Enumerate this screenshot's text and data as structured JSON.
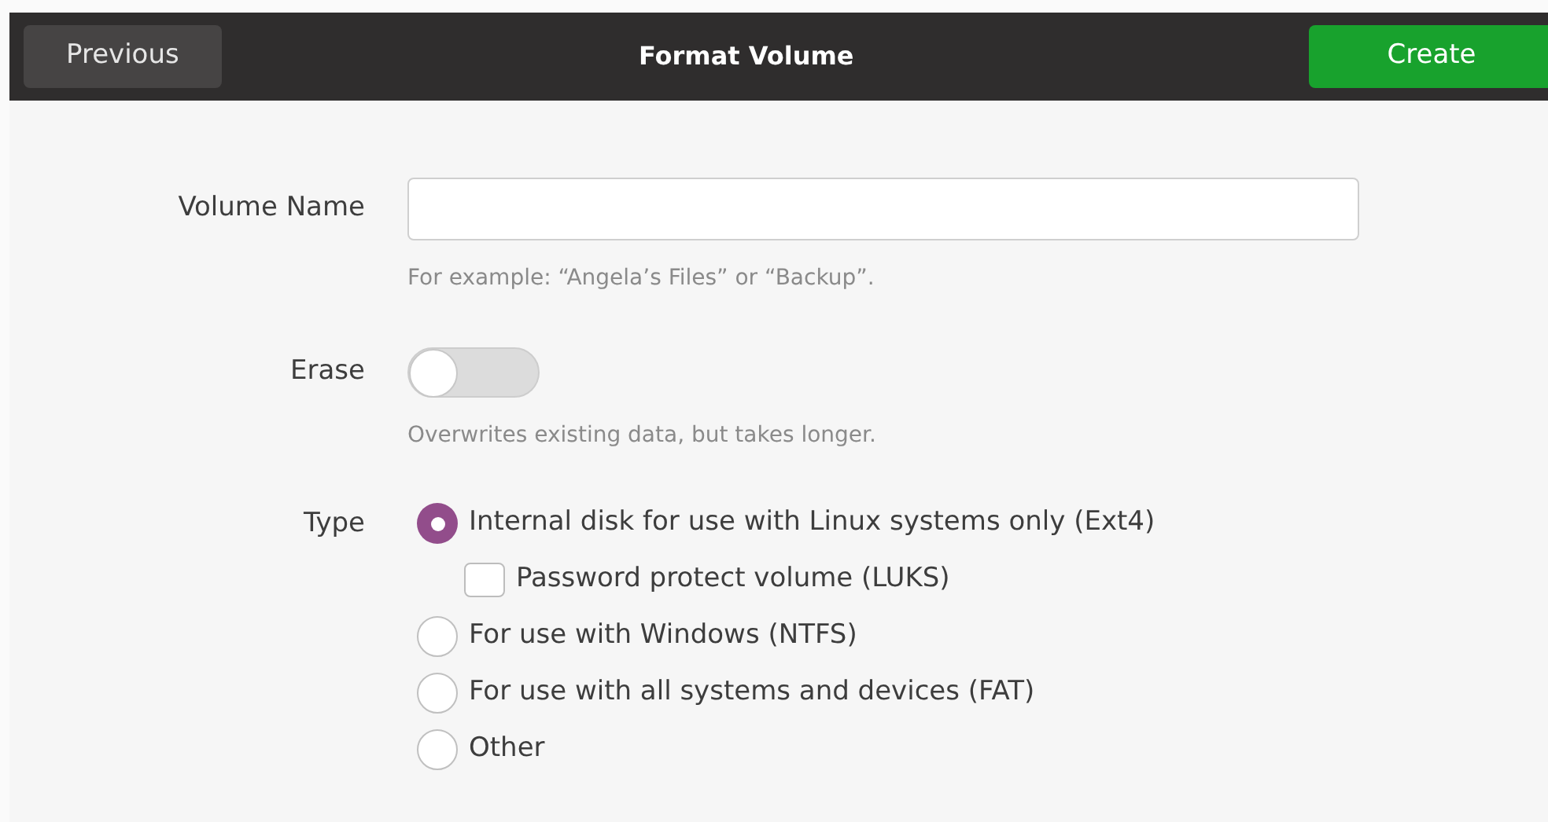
{
  "header": {
    "title": "Format Volume",
    "previous_button": "Previous",
    "create_button": "Create"
  },
  "volume_name": {
    "label": "Volume Name",
    "hint": "For example: “Angela’s Files” or “Backup”."
  },
  "erase": {
    "label": "Erase",
    "on": false,
    "hint": "Overwrites existing data, but takes longer."
  },
  "type": {
    "label": "Type",
    "options": [
      {
        "kind": "radio",
        "label": "Internal disk for use with Linux systems only (Ext4)",
        "selected": true
      },
      {
        "kind": "checkbox",
        "label": "Password protect volume (LUKS)",
        "checked": false
      },
      {
        "kind": "radio",
        "label": "For use with Windows (NTFS)",
        "selected": false
      },
      {
        "kind": "radio",
        "label": "For use with all systems and devices (FAT)",
        "selected": false
      },
      {
        "kind": "radio",
        "label": "Other",
        "selected": false
      }
    ]
  }
}
